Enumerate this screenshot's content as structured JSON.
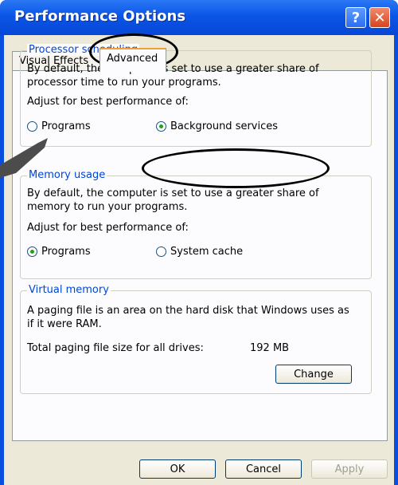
{
  "window": {
    "title": "Performance Options",
    "help_label": "?",
    "close_label": "✕"
  },
  "tabs": [
    {
      "label": "Visual Effects"
    },
    {
      "label": "Advanced"
    }
  ],
  "processor": {
    "title": "Processor scheduling",
    "desc1": "By default, the computer is set to use a greater share of",
    "desc2": "processor time to run your programs.",
    "adjust": "Adjust for best performance of:",
    "opt_programs": "Programs",
    "opt_background": "Background services"
  },
  "memory": {
    "title": "Memory usage",
    "desc1": "By default, the computer is set to use a greater share of",
    "desc2": "memory to run your programs.",
    "adjust": "Adjust for best performance of:",
    "opt_programs": "Programs",
    "opt_cache": "System cache"
  },
  "virtual": {
    "title": "Virtual memory",
    "desc1": "A paging file is an area on the hard disk that Windows uses as",
    "desc2": "if it were RAM.",
    "total_label": "Total paging file size for all drives:",
    "total_value": "192 MB",
    "change_label": "Change"
  },
  "footer": {
    "ok": "OK",
    "cancel": "Cancel",
    "apply": "Apply"
  },
  "colors": {
    "title_bar": "#0a55e6",
    "group_title": "#0046d5",
    "radio_dot": "#21a121",
    "tab_accent": "#f0a030"
  }
}
